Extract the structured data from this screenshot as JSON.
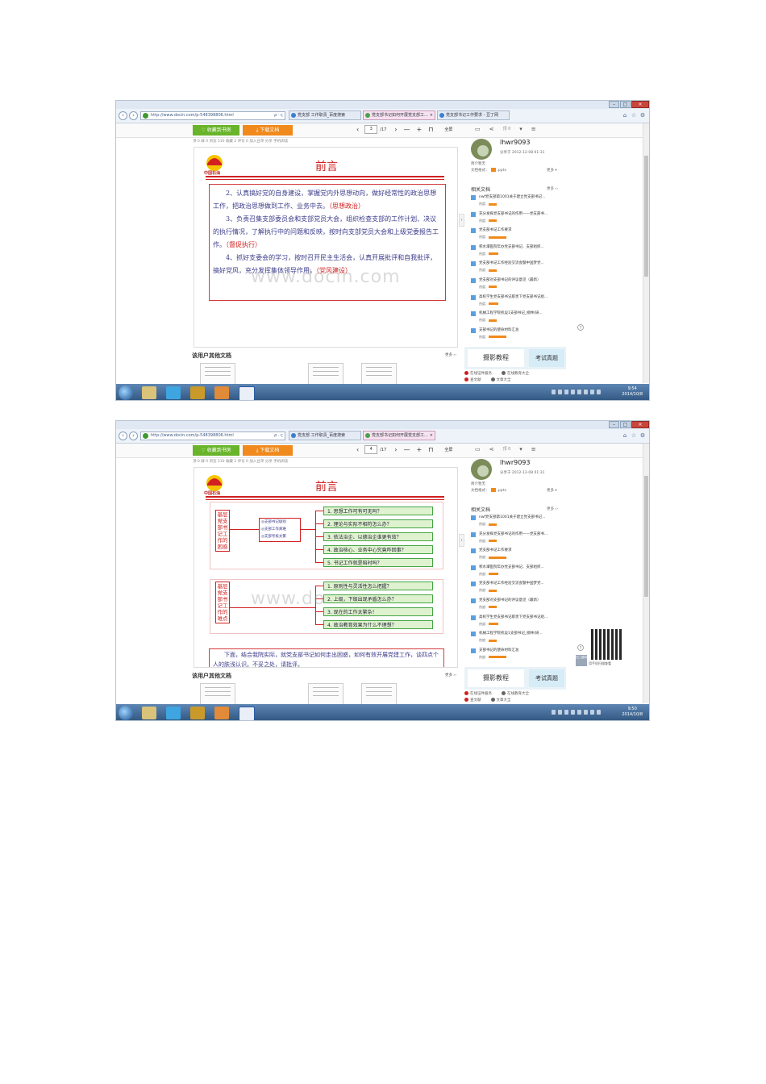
{
  "browser": {
    "url": "http://www.docin.com/p-548398806.html",
    "search_glyph": "ρ · ς",
    "tabs_1": [
      "党支部 工作职责_百度搜索",
      "党支部书记如何开展党支部工...",
      "党支部书记工作要求 - 豆丁网"
    ],
    "tabs_2": [
      "党支部 工作职责_百度搜索",
      "党支部书记如何开展党支部工..."
    ],
    "close_tab": "×"
  },
  "toolbar": {
    "favorite_label": "收藏到书房",
    "download_label": "下载文档",
    "page_current_1": "3",
    "page_current_2": "4",
    "page_total": "/17",
    "zoom_label": "全屏",
    "like_label": "顶 0",
    "subbar": "顶 0  踩 0  浏览 510  收藏 2  评论 0  加入豆单  分享  手机阅读"
  },
  "page1": {
    "logo_text": "中国石油",
    "heading": "前言",
    "para1": "2、认真搞好党的自身建设，掌握党内外思想动向，做好经常性的政治思想工作，把政治思想做到工作、业务中去。",
    "para1_tag": "（思想政治）",
    "para2": "3、负责召集支部委员会和支部党员大会，组织检查支部的工作计划、决议的执行情况，了解执行中的问题和反映，按时向支部党员大会和上级党委报告工作。",
    "para2_tag": "（督促执行）",
    "para3": "4、抓好支委会的学习，按时召开民主生活会，认真开展批评和自我批评，搞好党风，充分发挥集体领导作用。",
    "para3_tag": "（党风建设）",
    "watermark": "www.docin.com"
  },
  "page2": {
    "logo_text": "中国石油",
    "heading": "前言",
    "group1_label": "基层党支部书记工作的困惑",
    "group1_mid": [
      "◎支部书记级别",
      "◎支部工作真难",
      "◎支部考核太繁"
    ],
    "group1_items": [
      "1. 思想工作可有可无吗？",
      "2. 理论与实际不相符怎么办？",
      "3. 依法治企、以德治企谁更有效？",
      "4. 政治核心、业务中心究竟咋回事？",
      "5. 书记工作就是陪衬吗？"
    ],
    "group2_label": "基层党支部书记工作的难点",
    "group2_items": [
      "1. 原则性与灵活性怎么把握？",
      "2. 上级，下级出现矛盾怎么办？",
      "3. 现在的工作太繁杂！",
      "4. 政治教育效果为什么不理想？"
    ],
    "conclusion": "下面，结合我院实际，就党支部书记如何走出困惑，如何有效开展党建工作，谈四点个人的肤浅认识。不妥之处，请批评。",
    "watermark": "www.do"
  },
  "sidebar": {
    "username": "lhwr9093",
    "upload_date": "分享于 2012-12-08 01:31",
    "intro_label": "简介暂无",
    "format_label": "文档格式：",
    "format_value": ".pptx",
    "more_label": "更多 ▾",
    "related_title": "相关文档",
    "related_more": "更多 ››",
    "related": [
      "nwf党支部第1001关于建立党支部书记...",
      "充分发挥党支部书记的作用——党支部书...",
      "党支部书记工作要求",
      "积水潭医院年办党支部书记、支部组织...",
      "党支部书记工作经验交流会暨中国梦党...",
      "党支部对支部书记的评议意见（最新）",
      "高校学生党支部书记职责下党支部书记组...",
      "机械工程学院机设1支部书记_榜林(研...",
      "支部书记的使命材料汇总"
    ],
    "rating_label": "热度:",
    "ad_left": "摄影教程",
    "ad_right": "考试真题",
    "ad_row1_left": "在线证件服务",
    "ad_row1_right": "在线教育大全",
    "ad_row2_left": "查文献",
    "ad_row2_right": "文章大全",
    "qr_caption": "用手机扫描查看",
    "side_btn": "扫二维码"
  },
  "other_docs": {
    "title": "该用户其他文档",
    "more": "更多 ››"
  },
  "taskbar": {
    "time_1": "9:54",
    "time_2": "9:50",
    "date": "2014/10/8"
  }
}
